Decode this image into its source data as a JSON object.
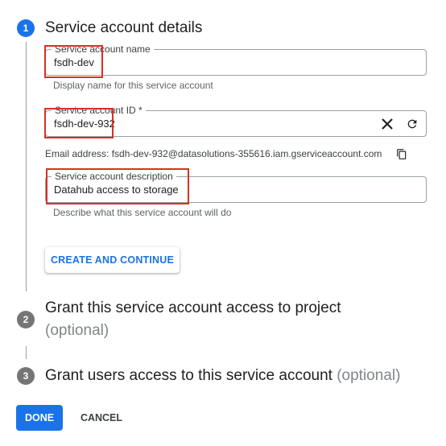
{
  "colors": {
    "accent": "#1a73e8",
    "step_inactive": "#757575",
    "highlight": "#d93025"
  },
  "steps": [
    {
      "number": "1",
      "title": "Service account details",
      "optional": ""
    },
    {
      "number": "2",
      "title": "Grant this service account access to project",
      "optional": "(optional)"
    },
    {
      "number": "3",
      "title": "Grant users access to this service account",
      "optional": "(optional)"
    }
  ],
  "form": {
    "name": {
      "label": "Service account name",
      "value": "fsdh-dev",
      "hint": "Display name for this service account"
    },
    "id": {
      "label": "Service account ID *",
      "value": "fsdh-dev-932",
      "clear_icon": "close-icon",
      "refresh_icon": "refresh-icon"
    },
    "email": {
      "text": "Email address: fsdh-dev-932@datasolutions-355616.iam.gserviceaccount.com",
      "copy_icon": "copy-icon"
    },
    "description": {
      "label": "Service account description",
      "value": "Datahub access to storage",
      "hint": "Describe what this service account will do"
    }
  },
  "buttons": {
    "create_continue": "CREATE AND CONTINUE",
    "done": "DONE",
    "cancel": "CANCEL"
  }
}
